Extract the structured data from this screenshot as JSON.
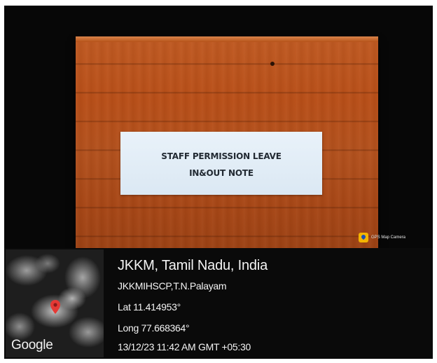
{
  "photo": {
    "label_line_1": "STAFF PERMISSION LEAVE",
    "label_line_2": "IN&OUT NOTE",
    "wood_color": "#b3511d",
    "card_color": "#e3edf6"
  },
  "gps_badge": {
    "text": "GPS Map Camera",
    "icon": "map-pin-icon"
  },
  "geo": {
    "place": "JKKM, Tamil Nadu, India",
    "address": "JKKMIHSCP,T.N.Palayam",
    "lat": "Lat 11.414953°",
    "long": "Long 77.668364°",
    "datetime": "13/12/23 11:42 AM GMT +05:30",
    "map_brand": "Google",
    "pin_color": "#e53935"
  }
}
